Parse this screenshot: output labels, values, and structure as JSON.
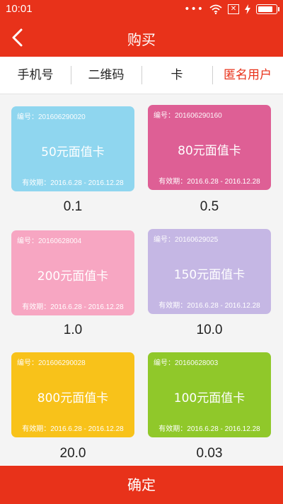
{
  "status": {
    "time": "10:01",
    "dots": "•••",
    "sim_icon": "x-box-icon",
    "battery_level": 0.85
  },
  "header": {
    "title": "购买",
    "back_icon": "chevron-left-icon"
  },
  "tabs": [
    {
      "label": "手机号",
      "active": false
    },
    {
      "label": "二维码",
      "active": false
    },
    {
      "label": "卡",
      "active": false
    },
    {
      "label": "匿名用户",
      "active": true
    }
  ],
  "cards": [
    {
      "serial": "编号：201606290020",
      "title": "50元面值卡",
      "validity": "有效期：2016.6.28 - 2016.12.28",
      "price": "0.1",
      "color": "#8fd6ef"
    },
    {
      "serial": "编号：201606290160",
      "title": "80元面值卡",
      "validity": "有效期：2016.6.28 - 2016.12.28",
      "price": "0.5",
      "color": "#de5f95"
    },
    {
      "serial": "编号：20160628004",
      "title": "200元面值卡",
      "validity": "有效期：2016.6.28 - 2016.12.28",
      "price": "1.0",
      "color": "#f7a6c2"
    },
    {
      "serial": "编号：20160629025",
      "title": "150元面值卡",
      "validity": "有效期：2016.6.28 - 2016.12.28",
      "price": "10.0",
      "color": "#c5b7e4"
    },
    {
      "serial": "编号：201606290028",
      "title": "800元面值卡",
      "validity": "有效期：2016.6.28 - 2016.12.28",
      "price": "20.0",
      "color": "#f8c21a"
    },
    {
      "serial": "编号：20160628003",
      "title": "100元面值卡",
      "validity": "有效期：2016.6.28 - 2016.12.28",
      "price": "0.03",
      "color": "#90c82a"
    }
  ],
  "footer": {
    "confirm_label": "确定"
  },
  "colors": {
    "brand": "#e8321a",
    "active_tab": "#e8321a"
  }
}
